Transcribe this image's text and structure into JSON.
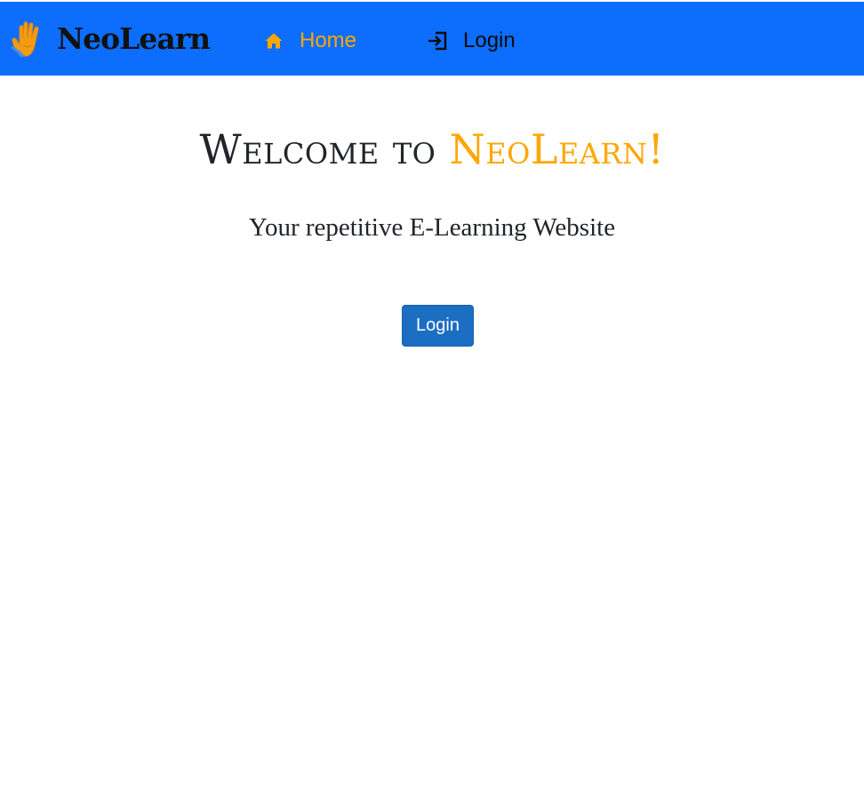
{
  "navbar": {
    "brand": {
      "name": "NeoLearn",
      "logo_icon": "hand-icon"
    },
    "links": {
      "home": {
        "label": "Home",
        "icon": "home-icon"
      },
      "login": {
        "label": "Login",
        "icon": "login-icon"
      }
    }
  },
  "hero": {
    "title_prefix": "Welcome to ",
    "title_brand": "NeoLearn!",
    "subtitle": "Your repetitive E-Learning Website",
    "button_label": "Login"
  },
  "colors": {
    "navbar_bg": "#0d6efd",
    "accent": "#ffa600",
    "button_bg": "#1b6ec2",
    "text": "#212529"
  }
}
